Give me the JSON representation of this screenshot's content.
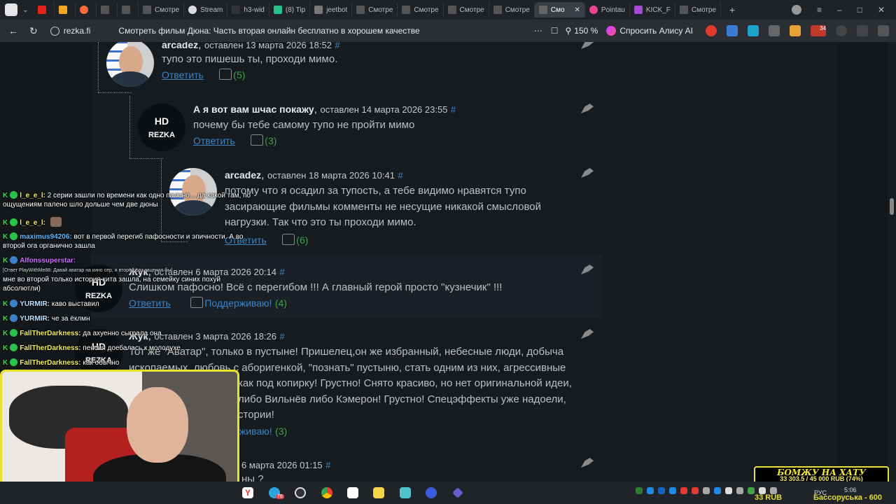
{
  "browser": {
    "tabs": [
      "",
      "",
      "",
      "",
      "",
      "Смотре",
      "Stream",
      "h3-wid",
      "(8) Tip",
      "jeetbot",
      "Смотре",
      "Смотре",
      "Смотре",
      "Смотре",
      "Смо",
      "Pointau",
      "KICK_F",
      "Смотре"
    ],
    "active_tab": "Смо",
    "url": "rezka.fi",
    "page_title": "Смотреть фильм Дюна: Часть вторая онлайн бесплатно в хорошем качестве",
    "zoom": "150 %",
    "alice": "Спросить Алису AI",
    "ext_badge": "34"
  },
  "comments": [
    {
      "id": "c1",
      "user": "arcadez",
      "meta": "оставлен 13 марта 2026 18:52",
      "hash": "#",
      "text": "тупо это пишешь ты, проходи мимо.",
      "reply": "Ответить",
      "likes": "(5)"
    },
    {
      "id": "c2",
      "user": "А я вот вам шчас покажу",
      "meta": "оставлен 14 марта 2026 23:55",
      "hash": "#",
      "text": "почему бы тебе самому тупо не пройти мимо",
      "reply": "Ответить",
      "likes": "(3)",
      "logo_a": "HD",
      "logo_b": "REZKA"
    },
    {
      "id": "c3",
      "user": "arcadez",
      "meta": "оставлен 18 марта 2026 10:41",
      "hash": "#",
      "text_lines": [
        "потому что я осадил за тупость, а тебе видимо нравятся тупо",
        "засирающие фильмы комменты не несущие никакой смысловой",
        "нагрузки. Так что это ты проходи мимо."
      ],
      "reply": "Ответить",
      "likes": "(6)"
    },
    {
      "id": "c4",
      "user": "Жук",
      "meta": "оставлен 6 марта 2026 20:14",
      "hash": "#",
      "text": "Слишком пафосно! Всё с перегибом !!! А главный герой просто \"кузнечик\" !!!",
      "reply": "Ответить",
      "support": "Поддерживаю!",
      "likes": "(4)",
      "logo_a": "HD",
      "logo_b": "REZKA"
    },
    {
      "id": "c5",
      "user": "Жук",
      "meta": "оставлен 3 марта 2026 18:26",
      "hash": "#",
      "text_lines": [
        "Тот же \"Аватар\", только в пустыне! Пришелец,он же избранный, небесные люди, добыча",
        "ископаемых, любовь с аборигенкой, \"познать\" пустыню, стать одним из них, агрессивные",
        "как под копирку! Грустно! Снято красиво, но нет оригинальной идеи,",
        "либо Вильнёв либо Кэмерон! Грустно! Спецэффекты уже надоели,",
        "стории!"
      ],
      "support": "живаю!",
      "likes": "(3)",
      "logo_a": "HD",
      "logo_b": "REZKA"
    },
    {
      "id": "c6",
      "meta": "6 марта 2026 01:15",
      "hash": "#",
      "text": "ны ?"
    }
  ],
  "chat": [
    {
      "user": "l_e_e_l:",
      "text": "2 серии зашли по времени как одно палено... да какой там, по ощущениям палено шло дольше чем две дюны"
    },
    {
      "user": "l_e_e_l:",
      "text": ""
    },
    {
      "user": "maximus94206:",
      "text": "вот в первой перегиб пафосности и эпичности. А во второй ога органично зашла"
    },
    {
      "user": "Alfonssuperstar:",
      "text": "мне во второй только история кита зашла, на семейку синих похуй абсолютли)",
      "note": "[Ответ PlayWithMe88: Давай аватар на кино сер, я второй раз заценил бы]"
    },
    {
      "user": "YURMIR:",
      "text": "каво выставил"
    },
    {
      "user": "YURMIR:",
      "text": "че за ёклмн"
    },
    {
      "user": "FallTherDarkness:",
      "text": "да ахуенно сыграла она"
    },
    {
      "user": "FallTherDarkness:",
      "text": "пенсия доебалась к молодухе"
    },
    {
      "user": "FallTherDarkness:",
      "text": "как обычно"
    }
  ],
  "donation": {
    "title": "БОМЖУ НА ХАТУ",
    "progress_text": "33 303.5 / 45 000 RUB (74%)",
    "progress_fraction": 0.74,
    "under_left": "33 RUB",
    "under_right": "Бассоруська - 600"
  },
  "taskbar": {
    "lang": "РУС",
    "time": "5:06",
    "tray_badge": "78"
  }
}
